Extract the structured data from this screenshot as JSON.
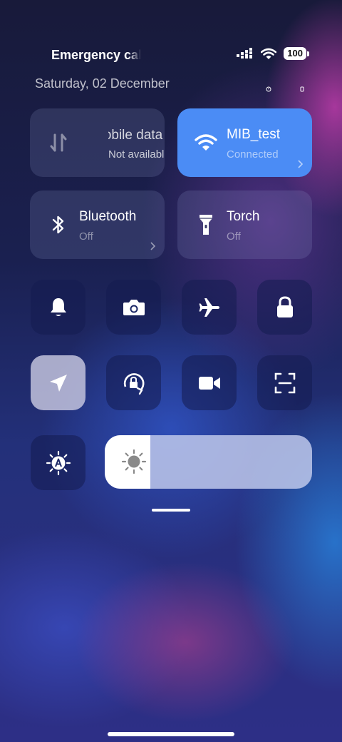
{
  "status_bar": {
    "carrier": "Emergency calls only",
    "battery": "100",
    "icons": [
      "signal-icon",
      "wifi-icon",
      "battery-icon"
    ]
  },
  "date": "Saturday, 02 December",
  "tiles": {
    "mobile_data": {
      "title": "Mobile data",
      "subtitle": "Not available",
      "icon": "mobile-data-icon"
    },
    "wifi": {
      "title": "MIB_test",
      "subtitle": "Connected",
      "icon": "wifi-icon",
      "active_color": "#4b8cf5"
    },
    "bluetooth": {
      "title": "Bluetooth",
      "subtitle": "Off",
      "icon": "bluetooth-icon"
    },
    "torch": {
      "title": "Torch",
      "subtitle": "Off",
      "icon": "torch-icon"
    }
  },
  "toggles": [
    {
      "name": "bell-icon",
      "active": false
    },
    {
      "name": "camera-icon",
      "active": false
    },
    {
      "name": "airplane-icon",
      "active": false
    },
    {
      "name": "lock-icon",
      "active": false
    },
    {
      "name": "location-icon",
      "active": true
    },
    {
      "name": "rotation-lock-icon",
      "active": false
    },
    {
      "name": "video-icon",
      "active": false
    },
    {
      "name": "scan-icon",
      "active": false
    },
    {
      "name": "auto-brightness-icon",
      "active": false
    }
  ],
  "brightness": {
    "level": 0.22
  },
  "colors": {
    "accent": "#4b8cf5"
  }
}
